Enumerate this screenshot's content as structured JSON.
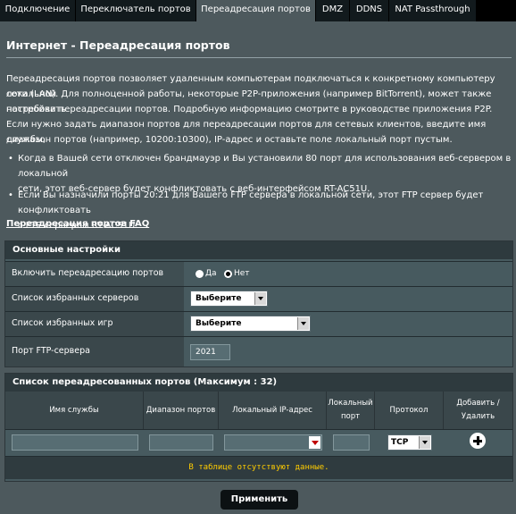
{
  "tabs": [
    {
      "label": "Подключение",
      "active": false
    },
    {
      "label": "Переключатель портов",
      "active": false
    },
    {
      "label": "Переадресация портов",
      "active": true
    },
    {
      "label": "DMZ",
      "active": false
    },
    {
      "label": "DDNS",
      "active": false
    },
    {
      "label": "NAT Passthrough",
      "active": false
    }
  ],
  "page_title": "Интернет - Переадресация портов",
  "description": {
    "lines": [
      "Переадресация портов позволяет удаленным компьютерам подключаться к конкретному компьютеру локальной",
      "сети (LAN). Для полноценной работы, некоторые P2P-приложения (например BitTorrent), может также потребовать",
      "настройки переадресации портов. Подробную информацию смотрите в руководстве приложения P2P.",
      "Если нужно задать диапазон портов для переадресации портов для сетевых клиентов, введите имя службы,",
      "диапазон портов (например, 10200:10300), IP-адрес и оставьте поле локальный порт пустым."
    ],
    "bullet1": [
      "Когда в Вашей сети отключен брандмауэр и Вы установили 80 порт для использования веб-сервером в локальной",
      "сети, этот веб-сервер будет конфликтовать с веб-интерфейсом RT-AC51U."
    ],
    "bullet2": [
      "Если Вы назначили порты 20:21 для Вашего FTP сервера в локальной сети, этот FTP сервер будет конфликтовать",
      "с FTP сервером RT-AC51U."
    ],
    "faq_link": "Переадресация портов FAQ"
  },
  "basic": {
    "header": "Основные настройки",
    "enable_label": "Включить переадресацию портов",
    "radio_yes": "Да",
    "radio_no": "Нет",
    "selected": "Нет",
    "servers_label": "Список избранных серверов",
    "servers_value": "Выберите",
    "games_label": "Список избранных игр",
    "games_value": "Выберите",
    "ftp_label": "Порт FTP-сервера",
    "ftp_value": "2021"
  },
  "list": {
    "header": "Список переадресованных портов (Максимум : 32)",
    "columns": {
      "service": "Имя службы",
      "range": "Диапазон портов",
      "ip": "Локальный IP-адрес",
      "local_port_1": "Локальный",
      "local_port_2": "порт",
      "protocol": "Протокол",
      "add_1": "Добавить /",
      "add_2": "Удалить"
    },
    "protocol_value": "TCP",
    "empty_text": "В таблице отсутствуют данные."
  },
  "apply_label": "Применить"
}
